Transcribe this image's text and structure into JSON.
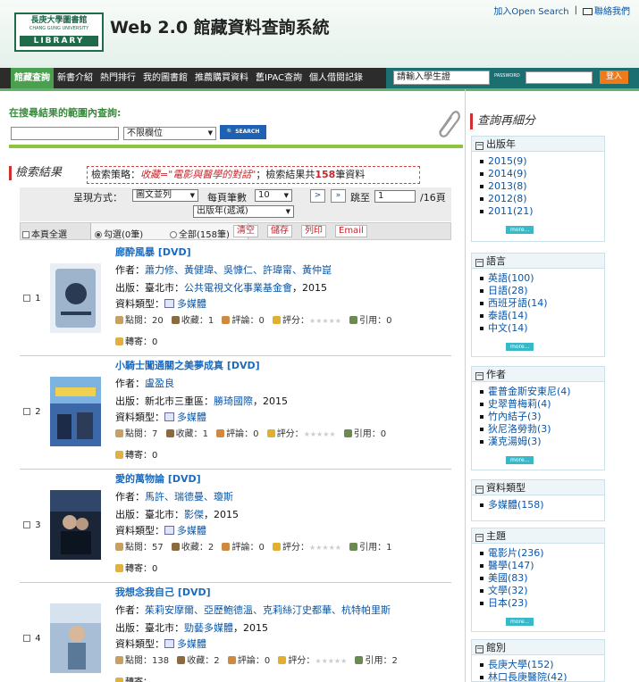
{
  "header": {
    "logo": {
      "line1": "長庚大學圖書館",
      "line2": "CHANG GUNG UNIVERSITY",
      "line3": "LIBRARY"
    },
    "title": "Web 2.0 館藏資料查詢系統",
    "top_links": {
      "add_open_search": "加入Open Search",
      "contact": "聯絡我們"
    }
  },
  "nav": {
    "items": [
      "館藏查詢",
      "新書介紹",
      "熱門排行",
      "我的圖書館",
      "推薦購買資料",
      "舊IPAC查詢",
      "個人借閱記錄"
    ],
    "login": {
      "account_placeholder": "請輸入學生證",
      "password_label": "PASSWORD",
      "login_button": "登入"
    }
  },
  "search": {
    "title": "在搜尋結果的範圍內查詢:",
    "query_value": "",
    "field_select": "不限欄位",
    "button": "SEARCH"
  },
  "results": {
    "title": "檢索結果",
    "strategy_prefix": "檢索策略：",
    "strategy_query": "收藏=\"電影與醫學的對話\"",
    "strategy_mid": "；檢索結果共",
    "total": "158",
    "strategy_suffix": "筆資料",
    "display_label": "呈現方式：",
    "display_value": "圖文並列",
    "per_page_label": "每頁筆數",
    "per_page_value": "10",
    "jump_label": "跳至",
    "page_current": "1",
    "page_total": "/16頁",
    "sort_value": "出版年(遞減)",
    "select_page_all": "本頁全選",
    "radio_checked": "勾選(0筆)",
    "radio_all": "全部(158筆)",
    "actions": [
      "清空",
      "儲存",
      "列印",
      "Email"
    ],
    "labels": {
      "author": "作者：",
      "publish": "出版：",
      "type": "資料類型：",
      "views": "點閱：",
      "favs": "收藏：",
      "comments": "評論：",
      "rating": "評分：",
      "cites": "引用：",
      "forward": "轉寄："
    },
    "records": [
      {
        "num": "1",
        "title": "廊酔風暴 [DVD]",
        "author": "蕭力修、黃健瑋、吳慷仁、許瑋甯、黃仲崑",
        "publish_place": "臺北市：",
        "publisher": "公共電視文化事業基金會",
        "year": "，2015",
        "type": "多媒體",
        "views": "20",
        "favs": "1",
        "comments": "0",
        "cites": "0",
        "forward": "0",
        "cover_color": "#5a7da8"
      },
      {
        "num": "2",
        "title": "小騎士闖通關之美夢成真 [DVD]",
        "author": "盧盈良",
        "publish_place": "新北市三重區：",
        "publisher": "勝琦國際",
        "year": "，2015",
        "type": "多媒體",
        "views": "7",
        "favs": "1",
        "comments": "0",
        "cites": "0",
        "forward": "0",
        "cover_color": "#4a6a9a"
      },
      {
        "num": "3",
        "title": "愛的萬物論 [DVD]",
        "author": "馬許、瑞德曼、瓊斯",
        "publish_place": "臺北市：",
        "publisher": "影傑",
        "year": "，2015",
        "type": "多媒體",
        "views": "57",
        "favs": "2",
        "comments": "0",
        "cites": "1",
        "forward": "0",
        "cover_color": "#24344e"
      },
      {
        "num": "4",
        "title": "我想念我自己 [DVD]",
        "author": "茱莉安摩爾、亞歷鮑德溫、克莉絲汀史都華、杭特帕里斯",
        "publish_place": "臺北市：",
        "publisher": "勁藝多媒體",
        "year": "，2015",
        "type": "多媒體",
        "views": "138",
        "favs": "2",
        "comments": "0",
        "cites": "2",
        "forward": "",
        "cover_color": "#7b98b8"
      }
    ]
  },
  "sidebar": {
    "title": "查詢再細分",
    "more_label": "more...",
    "facets": [
      {
        "name": "出版年",
        "items": [
          "2015(9)",
          "2014(9)",
          "2013(8)",
          "2012(8)",
          "2011(21)"
        ]
      },
      {
        "name": "語言",
        "items": [
          "英語(100)",
          "日語(28)",
          "西班牙語(14)",
          "泰語(14)",
          "中文(14)"
        ]
      },
      {
        "name": "作者",
        "items": [
          "霍普金斯安東尼(4)",
          "史翠普梅莉(4)",
          "竹內結子(3)",
          "狄尼洛勞勃(3)",
          "漢克湯姆(3)"
        ]
      },
      {
        "name": "資料類型",
        "items": [
          "多媒體(158)"
        ]
      },
      {
        "name": "主題",
        "items": [
          "電影片(236)",
          "醫學(147)",
          "美國(83)",
          "文學(32)",
          "日本(23)"
        ]
      },
      {
        "name": "館別",
        "items": [
          "長庚大學(152)",
          "林口長庚醫院(42)"
        ]
      }
    ]
  }
}
